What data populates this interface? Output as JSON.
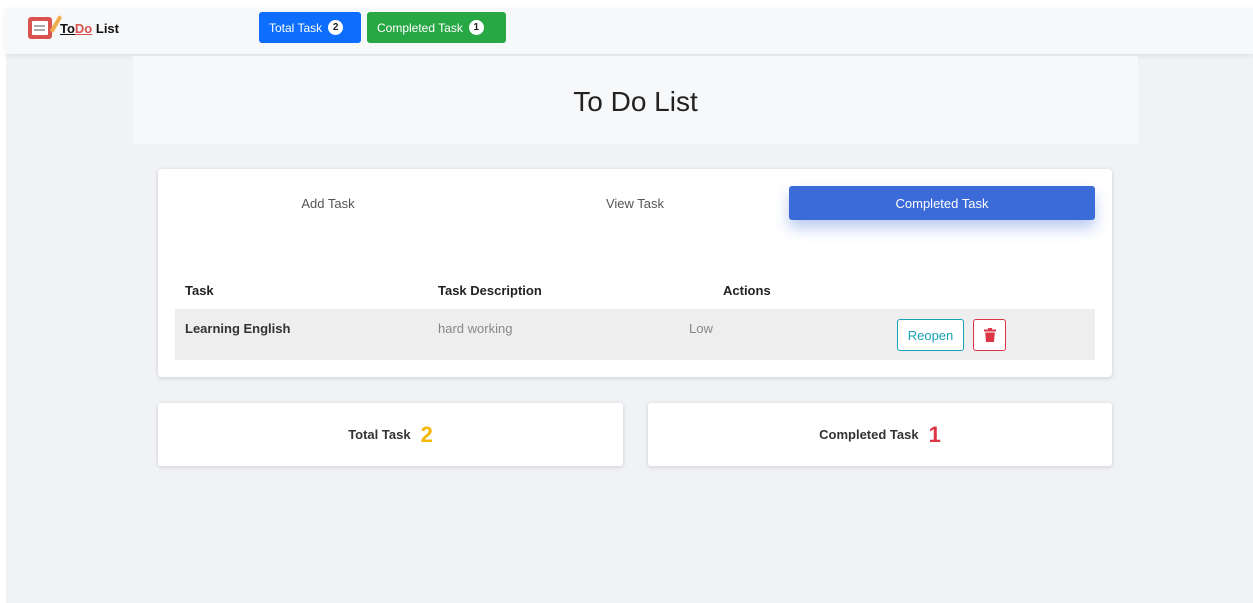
{
  "brand": {
    "to": "To",
    "do": "Do",
    "list": " List"
  },
  "nav": {
    "total_label": "Total Task",
    "total_count": "2",
    "completed_label": "Completed Task",
    "completed_count": "1"
  },
  "page_title": "To Do List",
  "tabs": [
    {
      "label": "Add Task",
      "active": false
    },
    {
      "label": "View Task",
      "active": false
    },
    {
      "label": "Completed Task",
      "active": true
    }
  ],
  "table": {
    "headers": [
      "Task",
      "Task Description",
      "Actions"
    ],
    "rows": [
      {
        "task": "Learning English",
        "description": "hard working",
        "priority": "Low",
        "action_label": "Reopen"
      }
    ]
  },
  "stats": {
    "total_label": "Total Task",
    "total_value": "2",
    "completed_label": "Completed Task",
    "completed_value": "1"
  },
  "colors": {
    "primary": "#0d6efd",
    "success": "#28a745",
    "active_tab": "#3b6ad9",
    "info": "#17a2b8",
    "danger": "#dc3545",
    "warning": "#f5b800"
  },
  "icons": {
    "delete": "trash-icon",
    "logo": "notepad-icon"
  }
}
